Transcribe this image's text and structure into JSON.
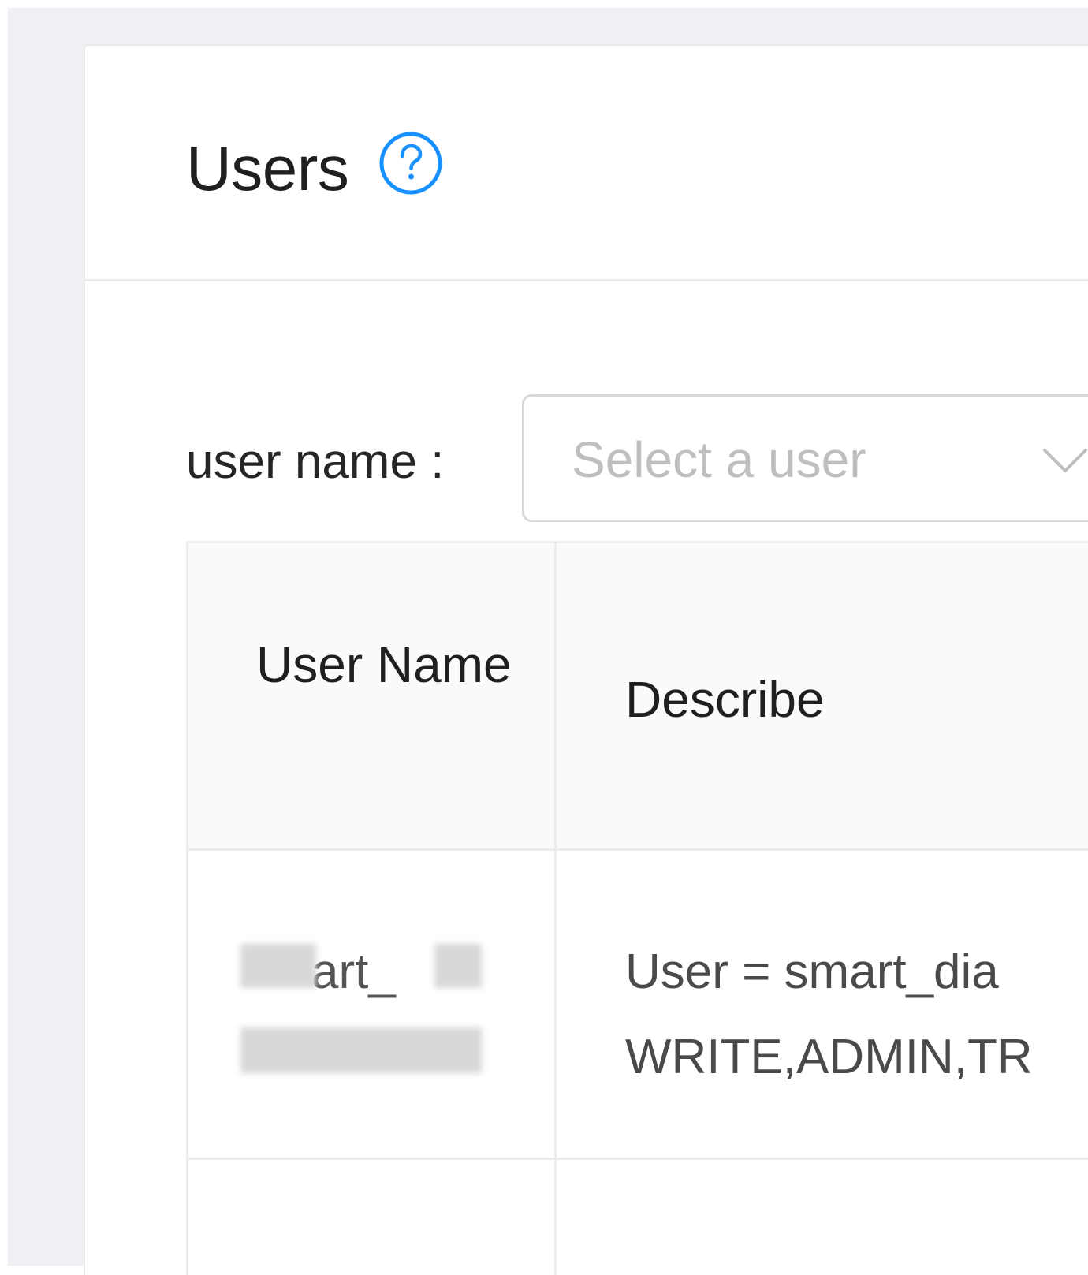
{
  "page": {
    "title": "Users"
  },
  "filter": {
    "label": "user name :",
    "placeholder": "Select a user"
  },
  "table": {
    "columns": [
      "User Name",
      "Describe"
    ],
    "rows": [
      {
        "user_name": "smart_diagnosis",
        "user_name_visible": "art_",
        "describe_line1": "User = smart_dia",
        "describe_line2": "WRITE,ADMIN,TR"
      }
    ]
  },
  "colors": {
    "accent": "#1890ff",
    "canvas_bg": "#eff0f4",
    "border": "#ececec",
    "header_bg": "#fafafa"
  },
  "icons": {
    "help": "question-circle-icon",
    "dropdown": "chevron-down-icon"
  }
}
